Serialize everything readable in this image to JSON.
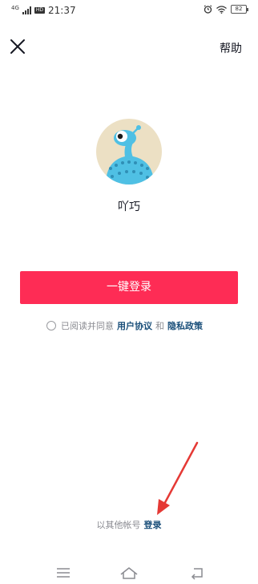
{
  "status_bar": {
    "network": "4G",
    "hd": "HD",
    "time": "21:37",
    "battery": "82"
  },
  "header": {
    "close_icon": "close-icon",
    "help_label": "帮助"
  },
  "profile": {
    "avatar_icon": "alien-avatar",
    "username": "吖巧"
  },
  "login": {
    "one_click_label": "一键登录",
    "agreement_prefix": "已阅读并同意",
    "user_agreement": "用户协议",
    "and_word": "和",
    "privacy_policy": "隐私政策",
    "other_account_text": "以其他帐号",
    "other_account_link": "登录"
  },
  "colors": {
    "primary": "#fe2c55",
    "link": "#1a4f7a",
    "annotation_arrow": "#e53935"
  },
  "nav_bar": {
    "icons": [
      "menu-icon",
      "home-icon",
      "back-icon"
    ]
  }
}
